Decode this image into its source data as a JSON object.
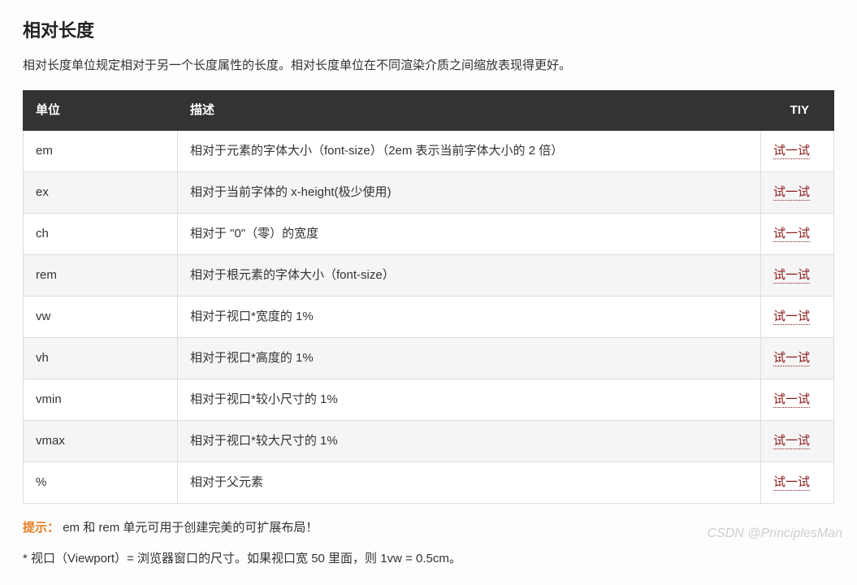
{
  "heading": "相对长度",
  "intro": "相对长度单位规定相对于另一个长度属性的长度。相对长度单位在不同渲染介质之间缩放表现得更好。",
  "table": {
    "headers": [
      "单位",
      "描述",
      "TIY"
    ],
    "rows": [
      {
        "unit": "em",
        "desc": "相对于元素的字体大小（font-size）（2em 表示当前字体大小的 2 倍）",
        "link": "试一试"
      },
      {
        "unit": "ex",
        "desc": "相对于当前字体的 x-height(极少使用)",
        "link": "试一试"
      },
      {
        "unit": "ch",
        "desc": "相对于 \"0\"（零）的宽度",
        "link": "试一试"
      },
      {
        "unit": "rem",
        "desc": "相对于根元素的字体大小（font-size）",
        "link": "试一试"
      },
      {
        "unit": "vw",
        "desc": "相对于视口*宽度的 1%",
        "link": "试一试"
      },
      {
        "unit": "vh",
        "desc": "相对于视口*高度的 1%",
        "link": "试一试"
      },
      {
        "unit": "vmin",
        "desc": "相对于视口*较小尺寸的 1%",
        "link": "试一试"
      },
      {
        "unit": "vmax",
        "desc": "相对于视口*较大尺寸的 1%",
        "link": "试一试"
      },
      {
        "unit": "%",
        "desc": "相对于父元素",
        "link": "试一试"
      }
    ]
  },
  "tip": {
    "label": "提示：",
    "text": "em 和 rem 单元可用于创建完美的可扩展布局！"
  },
  "footnote": "* 视口（Viewport）= 浏览器窗口的尺寸。如果视口宽 50 里面，则 1vw = 0.5cm。",
  "watermark": "CSDN @PrinciplesMan"
}
